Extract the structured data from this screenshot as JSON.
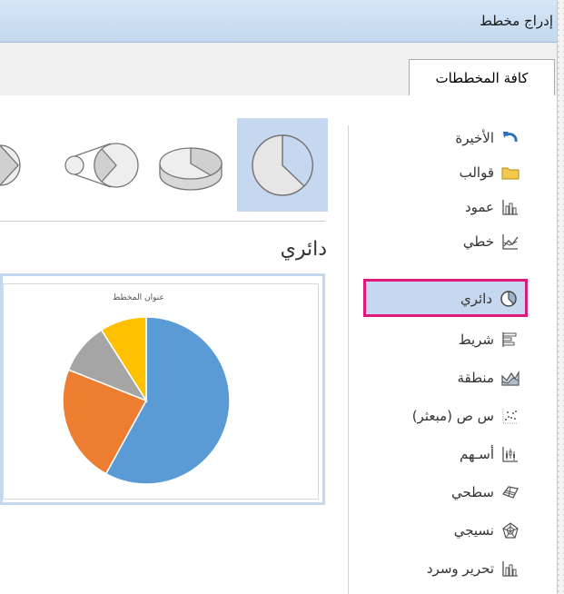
{
  "dialog": {
    "title": "إدراج مخطط"
  },
  "tabs": [
    {
      "label": "كافة المخططات"
    }
  ],
  "sidebar": {
    "items": [
      {
        "label": "الأخيرة",
        "icon": "undo-arrow-icon"
      },
      {
        "label": "قوالب",
        "icon": "folder-icon"
      },
      {
        "label": "عمود",
        "icon": "column-chart-icon"
      },
      {
        "label": "خطي",
        "icon": "line-chart-icon"
      },
      {
        "label": "دائري",
        "icon": "pie-chart-icon",
        "selected": true
      },
      {
        "label": "شريط",
        "icon": "bar-chart-icon"
      },
      {
        "label": "منطقة",
        "icon": "area-chart-icon"
      },
      {
        "label": "س ص (مبعثر)",
        "icon": "scatter-chart-icon"
      },
      {
        "label": "أسـهم",
        "icon": "stock-chart-icon"
      },
      {
        "label": "سطحي",
        "icon": "surface-chart-icon"
      },
      {
        "label": "نسيجي",
        "icon": "radar-chart-icon"
      },
      {
        "label": "تحرير وسرد",
        "icon": "combo-chart-icon"
      }
    ]
  },
  "main": {
    "type_title": "دائري",
    "preview_title": "عنوان المخطط"
  },
  "colors": {
    "accent_selection": "#c6d8ef",
    "highlight_border": "#e0187c",
    "pie_blue": "#5b9bd5",
    "pie_orange": "#ed7d31",
    "pie_gray": "#a5a5a5",
    "pie_yellow": "#ffc000"
  },
  "chart_data": {
    "type": "pie",
    "title": "عنوان المخطط",
    "values": [
      58,
      23,
      10,
      9
    ],
    "colors": [
      "#5b9bd5",
      "#ed7d31",
      "#a5a5a5",
      "#ffc000"
    ]
  }
}
